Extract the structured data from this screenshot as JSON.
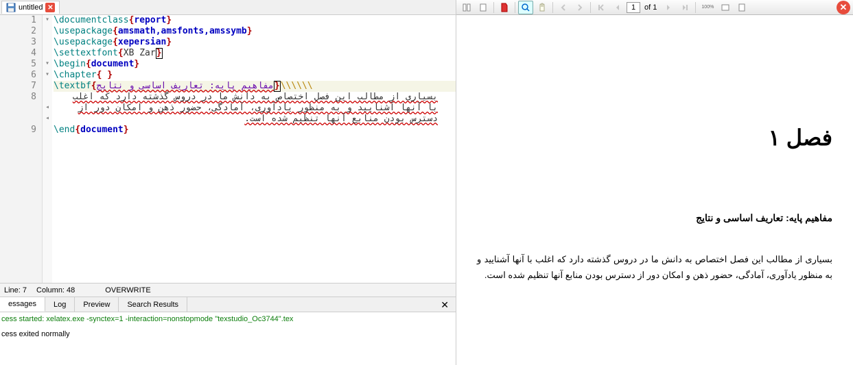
{
  "tab": {
    "title": "untitled"
  },
  "code": {
    "lines": [
      {
        "n": 1,
        "cmd": "\\documentclass",
        "arg": "report",
        "fold": "▾"
      },
      {
        "n": 2,
        "cmd": "\\usepackage",
        "arg": "amsmath,amsfonts,amssymb"
      },
      {
        "n": 3,
        "cmd": "\\usepackage",
        "arg": "xepersian"
      },
      {
        "n": 4,
        "cmd": "\\settextfont",
        "arg": "XB Zar",
        "boxed": true
      },
      {
        "n": 5,
        "cmd": "\\begin",
        "arg": "document",
        "fold": "▾"
      },
      {
        "n": 6,
        "cmd": "\\chapter",
        "arg": " ",
        "fold": "▾"
      },
      {
        "n": 7,
        "cmd": "\\textbf",
        "rtl_arg": "مفاهیم پایه: تعاریف اساسی و نتایج",
        "trailing": "\\\\\\\\\\\\",
        "boxed_close": true,
        "hl": true
      },
      {
        "n": 8,
        "rtl_text": "بسیاری از مطالب این فصل اختصاص به دانش ما در دروس گذشته دارد که اغلب"
      },
      {
        "n": "",
        "rtl_text": "با آنها آشنایید و به منظور یادآوری، آمادگی، حضور ذهن و امکان دور از",
        "fold": "◂"
      },
      {
        "n": "",
        "rtl_text": "دسترس بودن منابع آنها تنظیم شده است.",
        "fold": "◂"
      },
      {
        "n": 9,
        "cmd": "\\end",
        "arg": "document"
      }
    ]
  },
  "status": {
    "line": "Line: 7",
    "col": "Column: 48",
    "mode": "OVERWRITE"
  },
  "bottom_tabs": [
    "essages",
    "Log",
    "Preview",
    "Search Results"
  ],
  "log": {
    "start": "cess started: xelatex.exe -synctex=1 -interaction=nonstopmode \"texstudio_Oc3744\".tex",
    "end": "cess exited normally"
  },
  "pdf_toolbar": {
    "page_field": "1",
    "page_total": "of 1",
    "zoom_pct": "100%"
  },
  "pdf": {
    "chapter": "فصل ۱",
    "bold": "مفاهیم پایه: تعاریف اساسی و نتایج",
    "para": "بسیاری از مطالب این فصل اختصاص به دانش ما در دروس گذشته دارد که اغلب با آنها آشنایید و به منظور یادآوری، آمادگی، حضور ذهن و امکان دور از دسترس بودن منابع آنها تنظیم شده است."
  }
}
